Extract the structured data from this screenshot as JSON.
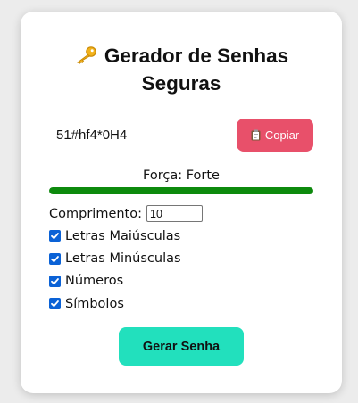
{
  "app": {
    "title": "Gerador de Senhas Seguras"
  },
  "password": {
    "value": "51#hf4*0H4",
    "copy_label": "Copiar"
  },
  "strength": {
    "label": "Força: Forte",
    "level": 1.0,
    "color": "#0d8a0d"
  },
  "options": {
    "length_label": "Comprimento:",
    "length_value": "10",
    "checks": [
      {
        "label": "Letras Maiúsculas",
        "checked": true
      },
      {
        "label": "Letras Minúsculas",
        "checked": true
      },
      {
        "label": "Números",
        "checked": true
      },
      {
        "label": "Símbolos",
        "checked": true
      }
    ]
  },
  "actions": {
    "generate_label": "Gerar Senha"
  },
  "colors": {
    "copy_button": "#e8506a",
    "generate_button": "#22e0bd",
    "checkbox": "#0b62d6"
  },
  "icons": {
    "title_icon": "key-icon",
    "copy_icon": "clipboard-icon",
    "check_icon": "checkmark-icon"
  }
}
